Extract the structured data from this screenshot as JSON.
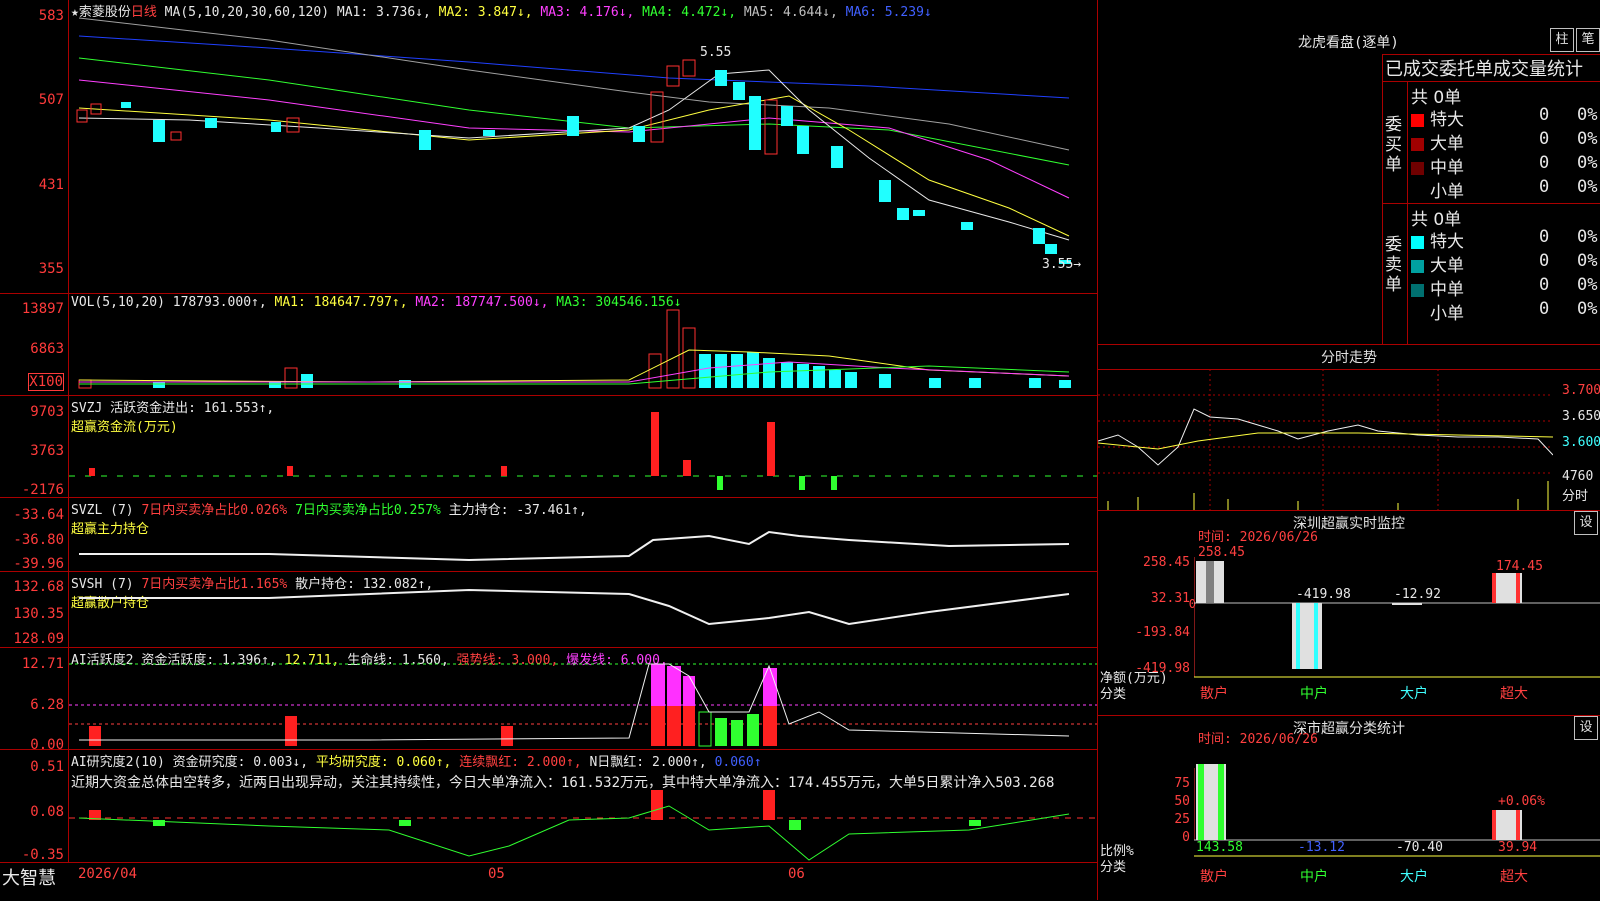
{
  "stock": {
    "name": "★索菱股份",
    "period": "日线"
  },
  "colors": {
    "up": "#ff3030",
    "down": "#20ffff",
    "grid": "#a00000",
    "ma1": "#e8e8e8",
    "ma2": "#ffff40",
    "ma3": "#ff40ff",
    "ma4": "#30ff30",
    "ma5": "#a0a0a0",
    "ma6": "#2040ff"
  },
  "main": {
    "ma_label": "MA(5,10,20,30,60,120)",
    "ma1": "MA1: 3.736↓,",
    "ma2": "MA2: 3.847↓,",
    "ma3": "MA3: 4.176↓,",
    "ma4": "MA4: 4.472↓,",
    "ma5": "MA5: 4.644↓,",
    "ma6": "MA6: 5.239↓",
    "y_labels": [
      "583",
      "507",
      "431",
      "355"
    ],
    "hi_label": "5.55",
    "lo_label": "3.55→"
  },
  "vol": {
    "label": "VOL(5,10,20)",
    "val": "178793.000↑,",
    "ma1": "MA1: 184647.797↑,",
    "ma2": "MA2: 187747.500↓,",
    "ma3": "MA3: 304546.156↓",
    "y_labels": [
      "13897",
      "6863",
      "X100"
    ]
  },
  "svzj": {
    "label": "SVZJ",
    "line": "活跃资金进出: 161.553↑,",
    "sub": "超赢资金流(万元)",
    "y_labels": [
      "9703",
      "3763",
      "-2176"
    ]
  },
  "svzl": {
    "label": "SVZL (7)",
    "a": "7日内买卖净占比0.026%",
    "b": "7日内买卖净占比0.257%",
    "c": "主力持仓: -37.461↑,",
    "sub": "超赢主力持仓",
    "y_labels": [
      "-33.64",
      "-36.80",
      "-39.96"
    ]
  },
  "svsh": {
    "label": "SVSH (7)",
    "a": "7日内买卖净占比1.165%",
    "c": "散户持仓: 132.082↑,",
    "sub": "超赢散户持仓",
    "y_labels": [
      "132.68",
      "130.35",
      "128.09"
    ]
  },
  "ai1": {
    "label": "AI活跃度2",
    "a": "资金活跃度: 1.396↑,",
    "b": "12.711,",
    "c": "生命线: 1.560,",
    "d": "强势线: 3.000,",
    "e": "爆发线: 6.000,",
    "y_labels": [
      "12.71",
      "6.28",
      "0.00"
    ]
  },
  "ai2": {
    "label": "AI研究度2(10)",
    "a": "资金研究度: 0.003↓,",
    "b": "平均研究度: 0.060↑,",
    "c": "连续飘红: 2.000↑,",
    "d": "N日飘红: 2.000↑,",
    "e": "0.060↑",
    "text": "近期大资金总体由空转多，近两日出现异动，关注其持续性，今日大单净流入：161.532万元，其中特大单净流入：174.455万元，大单5日累计净入503.268",
    "y_labels": [
      "0.51",
      "0.08",
      "-0.35"
    ]
  },
  "bottom": {
    "brand": "大智慧",
    "date": "2026/04",
    "m5": "05",
    "m6": "06"
  },
  "lhb": {
    "title": "龙虎看盘(逐单)",
    "btn_zhu": "柱",
    "btn_bi": "笔",
    "header": "已成交委托单成交量统计",
    "buy_label": "委买单",
    "sell_label": "委卖单",
    "buy_total": "共 0单",
    "sell_total": "共 0单",
    "buy_rows": [
      {
        "name": "特大",
        "n": "0",
        "p": "0%",
        "color": "#ff0000"
      },
      {
        "name": "大单",
        "n": "0",
        "p": "0%",
        "color": "#a00000"
      },
      {
        "name": "中单",
        "n": "0",
        "p": "0%",
        "color": "#700000"
      },
      {
        "name": "小单",
        "n": "0",
        "p": "0%",
        "color": ""
      }
    ],
    "sell_rows": [
      {
        "name": "特大",
        "n": "0",
        "p": "0%",
        "color": "#00ffff"
      },
      {
        "name": "大单",
        "n": "0",
        "p": "0%",
        "color": "#00a0a0"
      },
      {
        "name": "中单",
        "n": "0",
        "p": "0%",
        "color": "#007070"
      },
      {
        "name": "小单",
        "n": "0",
        "p": "0%",
        "color": ""
      }
    ]
  },
  "fenshi": {
    "title": "分时走势",
    "p1": "3.700",
    "p2": "3.650",
    "p3": "3.600",
    "vol": "4760",
    "unit": "分时"
  },
  "monitor": {
    "title": "深圳超赢实时监控",
    "btn": "设",
    "time": "时间: 2026/06/26",
    "y_labels": [
      "258.45",
      "32.31",
      "0",
      "-193.84",
      "-419.98"
    ],
    "ylabel": "净额(万元)",
    "xlabel": "分类",
    "cats": [
      "散户",
      "中户",
      "大户",
      "超大"
    ],
    "values": [
      258.45,
      -419.98,
      -12.92,
      174.45
    ],
    "val_labels": [
      "258.45",
      "-419.98",
      "-12.92",
      "174.45"
    ]
  },
  "stats": {
    "title": "深市超赢分类统计",
    "btn": "设",
    "time": "时间: 2026/06/26",
    "y_labels": [
      "75",
      "50",
      "25",
      "0"
    ],
    "ylabel": "比例%",
    "xlabel": "分类",
    "cats": [
      "散户",
      "中户",
      "大户",
      "超大"
    ],
    "val_labels": [
      "143.58",
      "-13.12",
      "-70.40",
      "39.94"
    ],
    "extra": "+0.06%"
  }
}
